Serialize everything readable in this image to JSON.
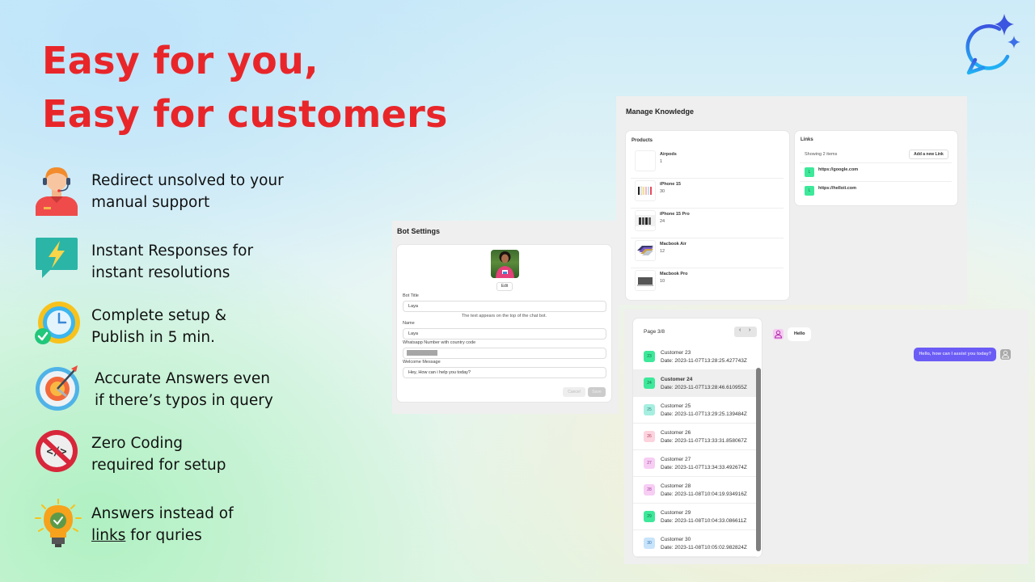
{
  "headline": {
    "line1": "Easy for you,",
    "line2": "Easy for customers",
    "color": "#e8262a"
  },
  "logo": {
    "icon": "chat-sparkle-icon"
  },
  "features": [
    {
      "icon": "support-agent-icon",
      "line1": "Redirect unsolved to your",
      "line2": "manual support"
    },
    {
      "icon": "lightning-chat-icon",
      "line1": "Instant Responses for",
      "line2": "instant resolutions"
    },
    {
      "icon": "clock-check-icon",
      "line1": "Complete setup &",
      "line2": "Publish in 5 min."
    },
    {
      "icon": "target-icon",
      "line1": "Accurate Answers even",
      "line2": "if there’s typos in query"
    },
    {
      "icon": "no-code-icon",
      "line1": "Zero Coding",
      "line2": "required for setup"
    },
    {
      "icon": "lightbulb-check-icon",
      "line1": "Answers instead of",
      "line2_underlined": "links",
      "line2_rest": " for quries"
    }
  ],
  "manage_knowledge": {
    "title": "Manage Knowledge",
    "products": {
      "heading": "Products",
      "items": [
        {
          "name": "Airpods",
          "count": "1"
        },
        {
          "name": "iPhone 15",
          "count": "30"
        },
        {
          "name": "iPhone 15 Pro",
          "count": "24"
        },
        {
          "name": "Macbook Air",
          "count": "12"
        },
        {
          "name": "Macbook Pro",
          "count": "10"
        }
      ]
    },
    "links": {
      "heading": "Links",
      "showing": "Showing 2 items",
      "add_button": "Add a new Link",
      "items": [
        {
          "badge": "L",
          "url": "https://google.com"
        },
        {
          "badge": "L",
          "url": "https://helloii.com"
        }
      ]
    }
  },
  "bot_settings": {
    "title": "Bot Settings",
    "edit_button": "Edit",
    "bot_title_label": "Bot Title",
    "bot_title_value": "Laya",
    "bot_title_hint": "The text appears on the top of the chat bot.",
    "name_label": "Name",
    "name_value": "Laya",
    "whatsapp_label": "Whatsapp Number with country code",
    "welcome_label": "Welcome Message",
    "welcome_value": "Hey, How can i help you today?",
    "cancel_button": "Cancel",
    "save_button": "Save"
  },
  "conversations": {
    "page": "Page 3/8",
    "prev": "‹",
    "next": "›",
    "items": [
      {
        "num": "23",
        "name": "Customer 23",
        "date": "Date: 2023-11-07T13:28:25.427743Z",
        "badge_bg": "#3de89a",
        "badge_fg": "#0f6e3f",
        "active": false
      },
      {
        "num": "24",
        "name": "Customer 24",
        "date": "Date: 2023-11-07T13:28:46.610955Z",
        "badge_bg": "#3de89a",
        "badge_fg": "#0f6e3f",
        "active": true
      },
      {
        "num": "25",
        "name": "Customer 25",
        "date": "Date: 2023-11-07T13:29:25.139484Z",
        "badge_bg": "#a6efe0",
        "badge_fg": "#2f7f70",
        "active": false
      },
      {
        "num": "26",
        "name": "Customer 26",
        "date": "Date: 2023-11-07T13:33:31.858067Z",
        "badge_bg": "#fcd3de",
        "badge_fg": "#b03a5a",
        "active": false
      },
      {
        "num": "27",
        "name": "Customer 27",
        "date": "Date: 2023-11-07T13:34:33.492674Z",
        "badge_bg": "#f7cdf4",
        "badge_fg": "#9a3a94",
        "active": false
      },
      {
        "num": "28",
        "name": "Customer 28",
        "date": "Date: 2023-11-08T10:04:19.934916Z",
        "badge_bg": "#f7cdf4",
        "badge_fg": "#9a3a94",
        "active": false
      },
      {
        "num": "29",
        "name": "Customer 29",
        "date": "Date: 2023-11-08T10:04:33.086611Z",
        "badge_bg": "#3de89a",
        "badge_fg": "#0f6e3f",
        "active": false
      },
      {
        "num": "30",
        "name": "Customer 30",
        "date": "Date: 2023-11-08T10:05:02.982824Z",
        "badge_bg": "#c8e4fb",
        "badge_fg": "#2f6fb0",
        "active": false
      }
    ],
    "chat": {
      "incoming": "Hello",
      "outgoing": "Hello, how can I assist you today?",
      "outgoing_color": "#6b5cf6"
    }
  }
}
